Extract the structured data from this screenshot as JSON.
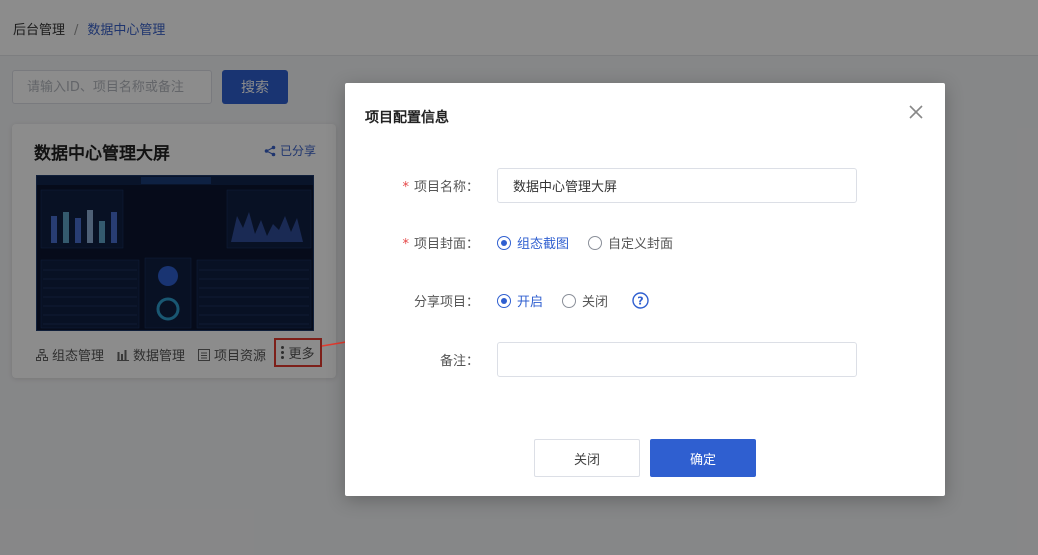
{
  "breadcrumb": {
    "root": "后台管理",
    "separator": "/",
    "current": "数据中心管理"
  },
  "search": {
    "placeholder": "请输入ID、项目名称或备注",
    "value": "",
    "button_label": "搜索"
  },
  "card": {
    "title": "数据中心管理大屏",
    "share_label": "已分享",
    "actions": [
      {
        "label": "组态管理",
        "icon": "topology-icon"
      },
      {
        "label": "数据管理",
        "icon": "bar-chart-icon"
      },
      {
        "label": "项目资源",
        "icon": "document-icon"
      }
    ],
    "more_label": "更多"
  },
  "modal": {
    "title": "项目配置信息",
    "fields": {
      "name": {
        "label": "项目名称：",
        "required": true,
        "value": "数据中心管理大屏"
      },
      "cover": {
        "label": "项目封面：",
        "required": true,
        "options": [
          "组态截图",
          "自定义封面"
        ],
        "selected": "组态截图"
      },
      "share": {
        "label": "分享项目：",
        "required": false,
        "options": [
          "开启",
          "关闭"
        ],
        "selected": "开启"
      },
      "remark": {
        "label": "备注：",
        "required": false,
        "value": ""
      }
    },
    "cancel_label": "关闭",
    "confirm_label": "确定"
  },
  "colors": {
    "primary": "#2f5fd0",
    "required_mark": "#e54545",
    "highlight_box": "#e33a2e",
    "overlay": "rgba(0,0,0,0.45)",
    "preview_bg": "#0b1530"
  }
}
